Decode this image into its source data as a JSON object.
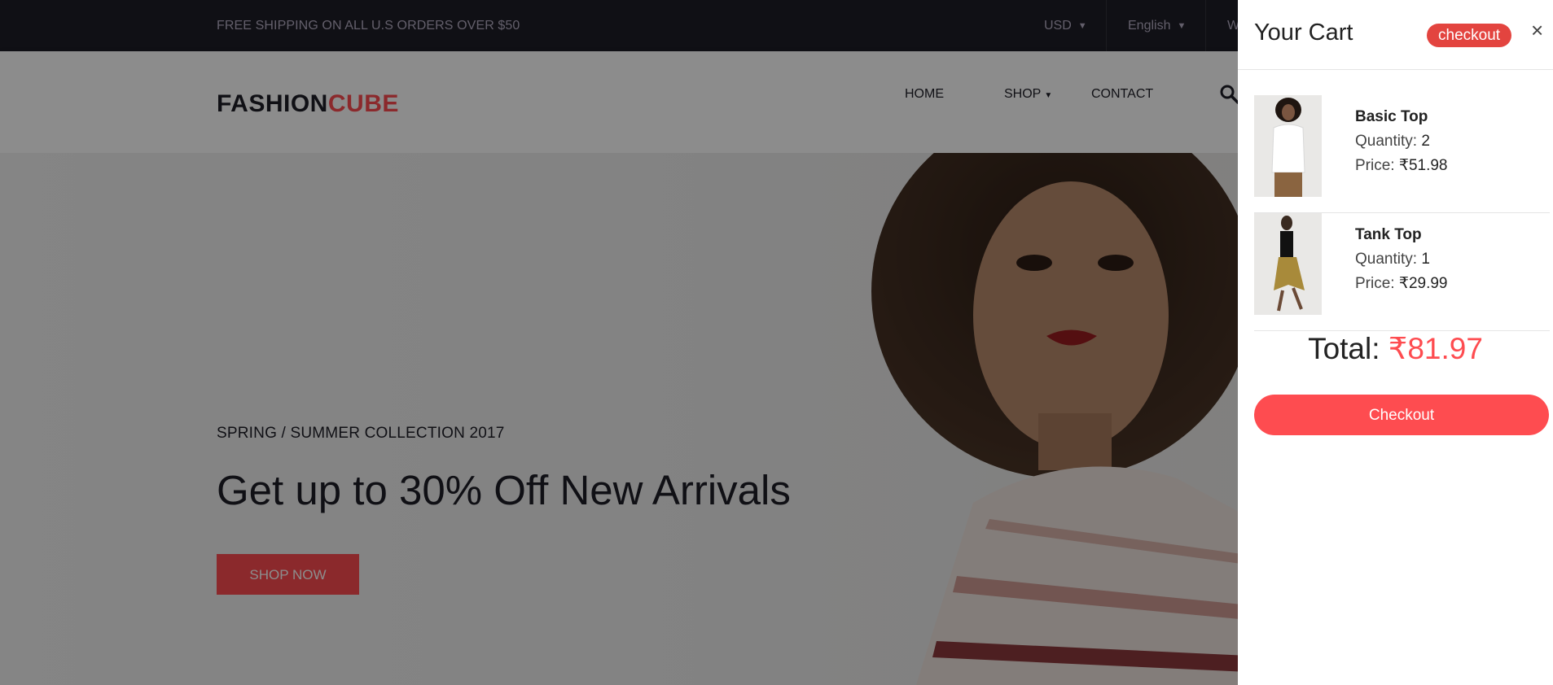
{
  "topbar": {
    "shipping_message": "FREE SHIPPING ON ALL U.S ORDERS OVER $50",
    "currency": "USD",
    "language": "English",
    "account_fragment": "W"
  },
  "header": {
    "logo_part1": "FASHION",
    "logo_part2": "CUBE",
    "nav": {
      "home": "HOME",
      "shop": "SHOP",
      "contact": "CONTACT"
    }
  },
  "hero": {
    "subtitle": "SPRING / SUMMER COLLECTION 2017",
    "title": "Get up to 30% Off New Arrivals",
    "cta": "SHOP NOW"
  },
  "cart": {
    "title": "Your Cart",
    "badge": "checkout",
    "close": "×",
    "quantity_label": "Quantity:",
    "price_label": "Price:",
    "items": [
      {
        "name": "Basic Top",
        "quantity": "2",
        "price": "₹51.98"
      },
      {
        "name": "Tank Top",
        "quantity": "1",
        "price": "₹29.99"
      }
    ],
    "total_label": "Total:",
    "total_value": "₹81.97",
    "checkout_button": "Checkout"
  },
  "colors": {
    "accent": "#fe4c50",
    "topbar_bg": "#1e1e27",
    "badge": "#e3443f"
  }
}
